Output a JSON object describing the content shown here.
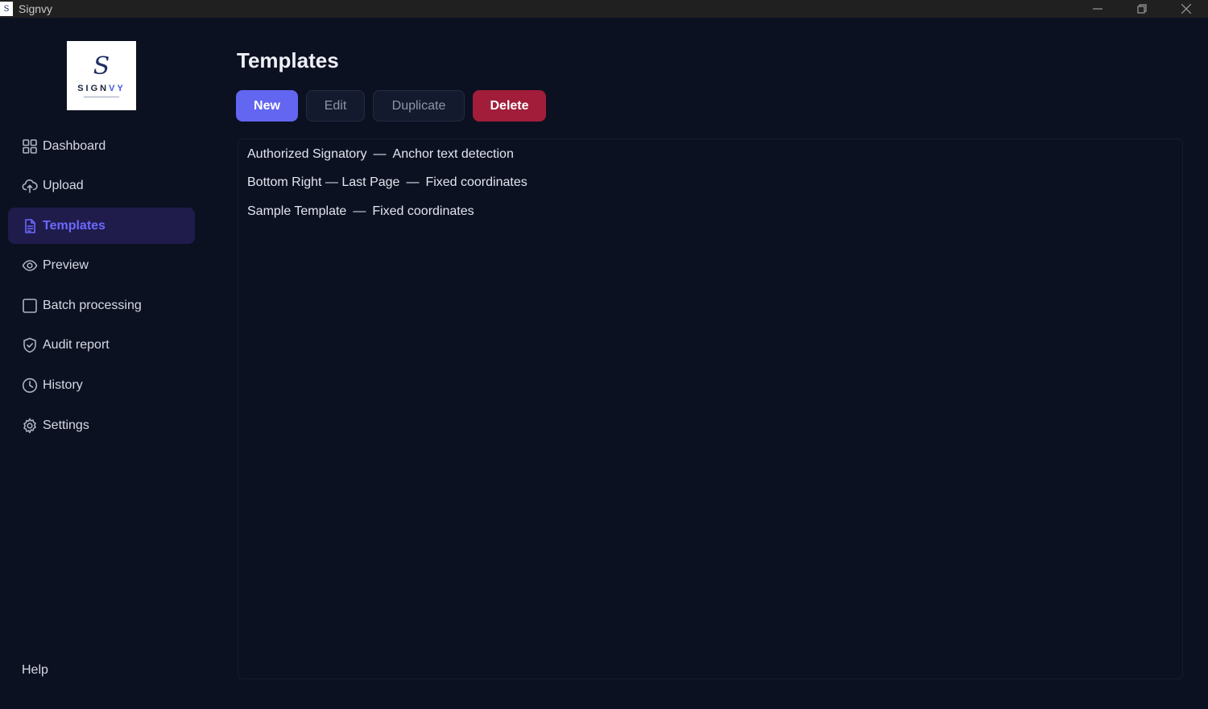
{
  "window": {
    "title": "Signvy",
    "app_icon": "signvy-logo-icon"
  },
  "sidebar": {
    "logo": {
      "mark": "S",
      "word_main": "SIGN",
      "word_accent": "VY"
    },
    "items": [
      {
        "label": "Dashboard",
        "icon": "dashboard-grid-icon"
      },
      {
        "label": "Upload",
        "icon": "cloud-upload-icon"
      },
      {
        "label": "Templates",
        "icon": "document-icon",
        "active": true
      },
      {
        "label": "Preview",
        "icon": "eye-icon"
      },
      {
        "label": "Batch processing",
        "icon": "square-icon"
      },
      {
        "label": "Audit report",
        "icon": "shield-check-icon"
      },
      {
        "label": "History",
        "icon": "clock-icon"
      },
      {
        "label": "Settings",
        "icon": "gear-icon"
      }
    ],
    "help_label": "Help"
  },
  "main": {
    "title": "Templates",
    "toolbar": {
      "new_label": "New",
      "edit_label": "Edit",
      "duplicate_label": "Duplicate",
      "delete_label": "Delete"
    },
    "templates": [
      {
        "name": "Authorized Signatory",
        "method": "Anchor text detection"
      },
      {
        "name": "Bottom Right — Last Page",
        "method": "Fixed coordinates"
      },
      {
        "name": "Sample Template",
        "method": "Fixed coordinates"
      }
    ],
    "separator": "—"
  },
  "colors": {
    "background": "#0c1122",
    "accent": "#6366f1",
    "active_nav_bg": "#1f1c4c",
    "danger": "#a11d3a"
  }
}
